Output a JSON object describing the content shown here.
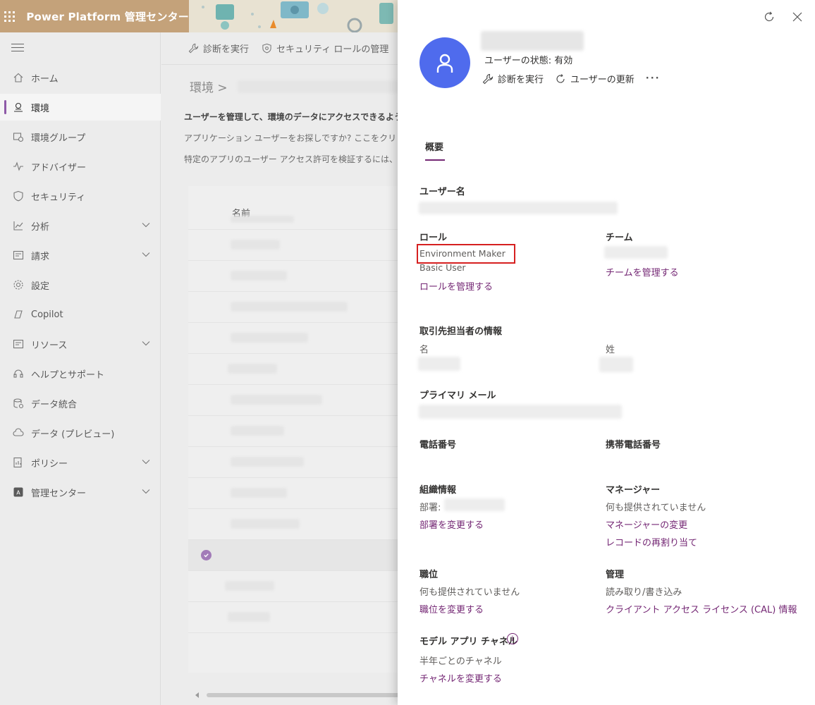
{
  "header": {
    "app_title": "Power Platform 管理センター"
  },
  "sidebar": {
    "items": [
      {
        "label": "ホーム",
        "icon": "home-icon"
      },
      {
        "label": "環境",
        "icon": "environment-icon"
      },
      {
        "label": "環境グループ",
        "icon": "environment-group-icon"
      },
      {
        "label": "アドバイザー",
        "icon": "advisor-icon"
      },
      {
        "label": "セキュリティ",
        "icon": "shield-icon"
      },
      {
        "label": "分析",
        "icon": "analytics-icon"
      },
      {
        "label": "請求",
        "icon": "billing-icon"
      },
      {
        "label": "設定",
        "icon": "gear-icon"
      },
      {
        "label": "Copilot",
        "icon": "copilot-icon"
      },
      {
        "label": "リソース",
        "icon": "resources-icon"
      },
      {
        "label": "ヘルプとサポート",
        "icon": "headset-icon"
      },
      {
        "label": "データ統合",
        "icon": "data-integration-icon"
      },
      {
        "label": "データ (プレビュー)",
        "icon": "cloud-data-icon"
      },
      {
        "label": "ポリシー",
        "icon": "policy-icon"
      },
      {
        "label": "管理センター",
        "icon": "admin-center-icon"
      }
    ]
  },
  "main": {
    "commands": {
      "run_diagnostics": "診断を実行",
      "manage_security_roles": "セキュリティ ロールの管理"
    },
    "breadcrumb": "環境 >",
    "description_lines": [
      "ユーザーを管理して、環境のデータにアクセスできるようにし",
      "アプリケーション ユーザーをお探しですか? ここをクリックして",
      "特定のアプリのユーザー アクセス許可を検証するには、ア"
    ],
    "grid": {
      "column_name": "名前"
    }
  },
  "panel": {
    "user_status": "ユーザーの状態: 有効",
    "actions": {
      "run_diagnostics": "診断を実行",
      "refresh_user": "ユーザーの更新",
      "more": "···"
    },
    "tabs": {
      "overview": "概要"
    },
    "username": {
      "label": "ユーザー名"
    },
    "roles": {
      "label": "ロール",
      "items": [
        "Environment Maker",
        "Basic User"
      ],
      "manage_link": "ロールを管理する"
    },
    "team": {
      "label": "チーム",
      "manage_link": "チームを管理する"
    },
    "contact": {
      "section_label": "取引先担当者の情報",
      "first_name_label": "名",
      "last_name_label": "姓"
    },
    "primary_email": {
      "label": "プライマリ メール"
    },
    "phone": {
      "label": "電話番号"
    },
    "mobile_phone": {
      "label": "携帯電話番号"
    },
    "organization": {
      "label": "組織情報",
      "department_label": "部署:",
      "change_department_link": "部署を変更する"
    },
    "manager": {
      "label": "マネージャー",
      "value": "何も提供されていません",
      "change_manager_link": "マネージャーの変更",
      "reassign_records_link": "レコードの再割り当て"
    },
    "position": {
      "label": "職位",
      "value": "何も提供されていません",
      "change_link": "職位を変更する"
    },
    "administration": {
      "label": "管理",
      "value": "読み取り/書き込み",
      "cal_link": "クライアント アクセス ライセンス (CAL) 情報"
    },
    "model_app_channel": {
      "label": "モデル アプリ チャネル",
      "value": "半年ごとのチャネル",
      "change_link": "チャネルを変更する"
    }
  }
}
